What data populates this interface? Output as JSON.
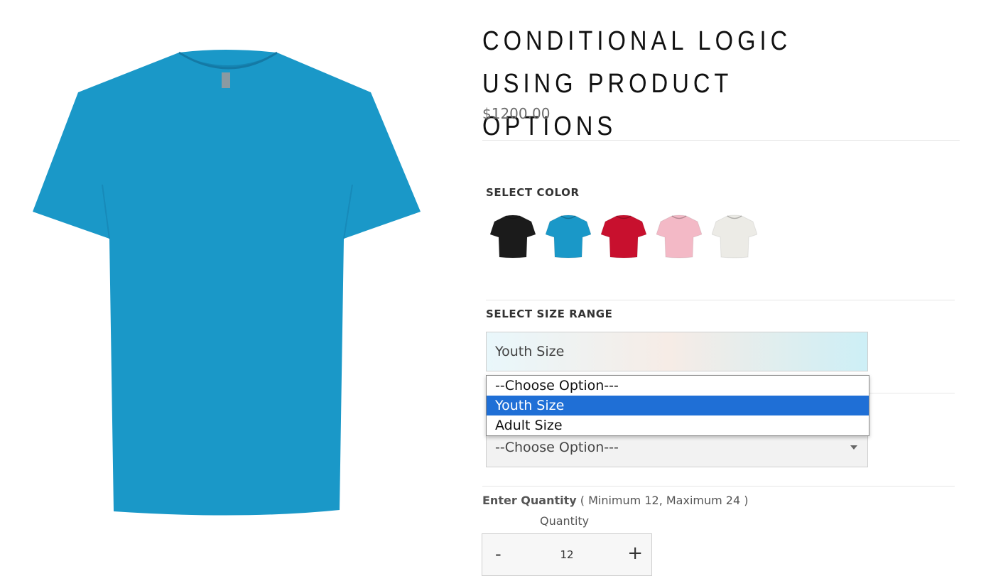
{
  "product": {
    "title": "CONDITIONAL LOGIC USING PRODUCT OPTIONS",
    "price": "$1200.00",
    "image_icon": "teal-tshirt",
    "image_color": "#1a98c8"
  },
  "color_option": {
    "label": "SELECT COLOR",
    "swatches": [
      {
        "name": "black",
        "color": "#1b1b1b"
      },
      {
        "name": "teal",
        "color": "#1a98c8"
      },
      {
        "name": "red",
        "color": "#c8102e"
      },
      {
        "name": "pink",
        "color": "#f3b9c6"
      },
      {
        "name": "white",
        "color": "#ecebe6"
      }
    ]
  },
  "size_range": {
    "label": "SELECT SIZE RANGE",
    "value": "Youth Size",
    "options": [
      "--Choose Option---",
      "Youth Size",
      "Adult Size"
    ],
    "selected_index": 1
  },
  "second_select": {
    "value": "--Choose Option---"
  },
  "quantity": {
    "label": "Enter Quantity",
    "hint": "( Minimum 12, Maximum 24 )",
    "caption": "Quantity",
    "minus": "-",
    "value": "12",
    "plus": "+"
  },
  "colors": {
    "accent_selected": "#1f6fd6"
  }
}
